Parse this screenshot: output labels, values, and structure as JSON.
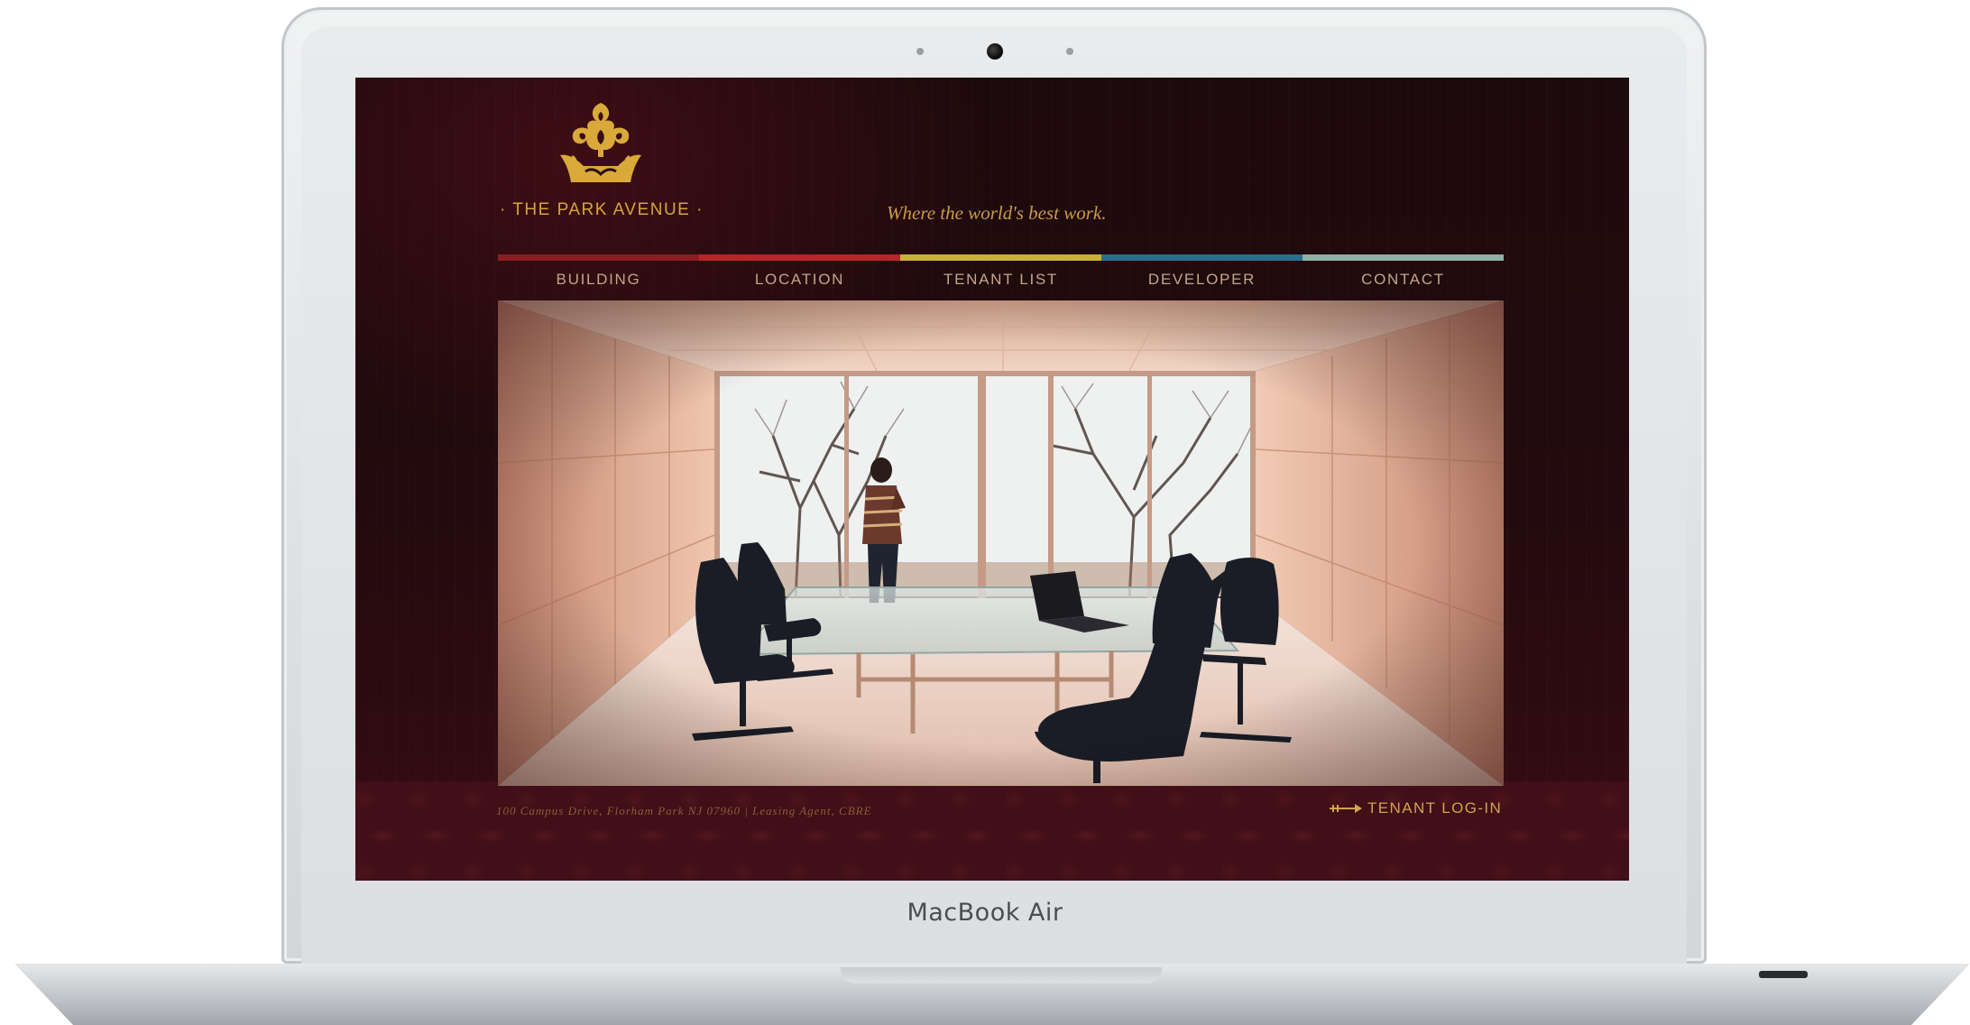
{
  "device": {
    "brand_label": "MacBook Air"
  },
  "site": {
    "logo_text": "· THE PARK AVENUE ·",
    "tagline": "Where the world's best work.",
    "nav": [
      {
        "label": "BUILDING",
        "color": "#8b1e22"
      },
      {
        "label": "LOCATION",
        "color": "#b52629"
      },
      {
        "label": "TENANT LIST",
        "color": "#c9b13a"
      },
      {
        "label": "DEVELOPER",
        "color": "#2a6e8e"
      },
      {
        "label": "CONTACT",
        "color": "#8cb0a4"
      }
    ],
    "footer_address": "100 Campus Drive, Florham Park NJ 07960 | Leasing Agent, CBRE",
    "login_label": "TENANT LOG-IN"
  },
  "icons": {
    "logo": "ornamental-crown-icon",
    "login": "arrow-right-icon",
    "camera": "webcam-icon"
  },
  "colors": {
    "background": "#210a0d",
    "gold": "#d6a53c",
    "tagline": "#c99a49",
    "nav_text": "#c3a58a"
  }
}
